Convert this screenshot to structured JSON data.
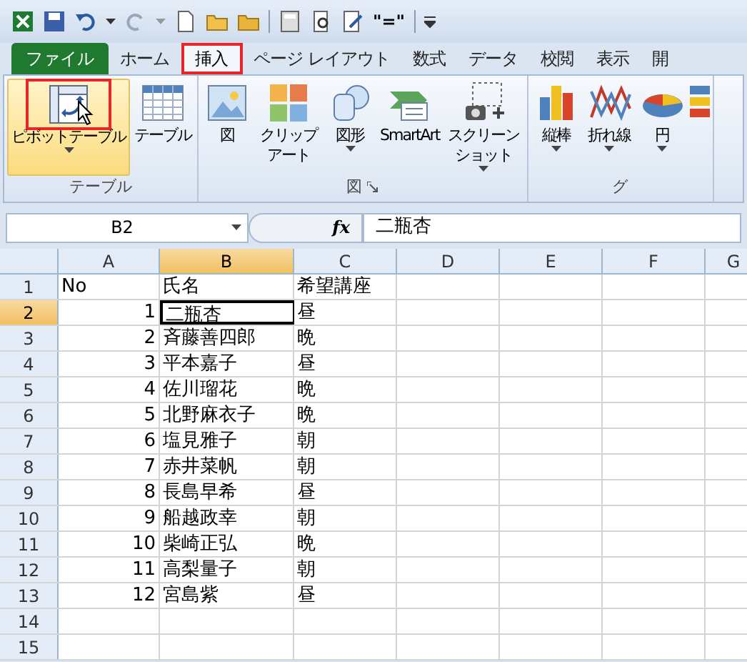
{
  "quick_access": {
    "formula_button": "\"=\""
  },
  "tabs": [
    {
      "label": "ファイル",
      "kind": "file",
      "selected": false
    },
    {
      "label": "ホーム",
      "kind": "tab",
      "selected": false
    },
    {
      "label": "挿入",
      "kind": "tab",
      "selected": true
    },
    {
      "label": "ページ レイアウト",
      "kind": "tab",
      "selected": false
    },
    {
      "label": "数式",
      "kind": "tab",
      "selected": false
    },
    {
      "label": "データ",
      "kind": "tab",
      "selected": false
    },
    {
      "label": "校閲",
      "kind": "tab",
      "selected": false
    },
    {
      "label": "表示",
      "kind": "tab",
      "selected": false
    },
    {
      "label": "開",
      "kind": "tab",
      "selected": false
    }
  ],
  "ribbon": {
    "groups": [
      {
        "label": "テーブル",
        "launcher": false,
        "buttons": [
          {
            "label": "ピボットテーブル",
            "dropdown": true,
            "highlighted": true
          },
          {
            "label": "テーブル",
            "dropdown": false,
            "highlighted": false
          }
        ]
      },
      {
        "label": "図",
        "launcher": true,
        "buttons": [
          {
            "label": "図",
            "dropdown": false,
            "highlighted": false
          },
          {
            "label": "クリップアート",
            "dropdown": false,
            "highlighted": false
          },
          {
            "label": "図形",
            "dropdown": true,
            "highlighted": false
          },
          {
            "label": "SmartArt",
            "dropdown": false,
            "highlighted": false
          },
          {
            "label": "スクリーンショット",
            "dropdown": true,
            "highlighted": false
          }
        ]
      },
      {
        "label": "グ",
        "launcher": false,
        "buttons": [
          {
            "label": "縦棒",
            "dropdown": true,
            "highlighted": false
          },
          {
            "label": "折れ線",
            "dropdown": true,
            "highlighted": false
          },
          {
            "label": "円",
            "dropdown": true,
            "highlighted": false
          }
        ]
      }
    ]
  },
  "formula_bar": {
    "name_box": "B2",
    "function_label": "fx",
    "formula": "二瓶杏"
  },
  "sheet": {
    "columns": [
      {
        "label": "A",
        "selected": false
      },
      {
        "label": "B",
        "selected": true
      },
      {
        "label": "C",
        "selected": false
      },
      {
        "label": "D",
        "selected": false
      },
      {
        "label": "E",
        "selected": false
      },
      {
        "label": "F",
        "selected": false
      },
      {
        "label": "G",
        "selected": false
      }
    ],
    "rows": [
      {
        "number": "1",
        "selected": false,
        "cells": [
          "No",
          "氏名",
          "希望講座"
        ]
      },
      {
        "number": "2",
        "selected": true,
        "cells": [
          "1",
          "二瓶杏",
          "昼"
        ]
      },
      {
        "number": "3",
        "selected": false,
        "cells": [
          "2",
          "斉藤善四郎",
          "晩"
        ]
      },
      {
        "number": "4",
        "selected": false,
        "cells": [
          "3",
          "平本嘉子",
          "昼"
        ]
      },
      {
        "number": "5",
        "selected": false,
        "cells": [
          "4",
          "佐川瑠花",
          "晩"
        ]
      },
      {
        "number": "6",
        "selected": false,
        "cells": [
          "5",
          "北野麻衣子",
          "晩"
        ]
      },
      {
        "number": "7",
        "selected": false,
        "cells": [
          "6",
          "塩見雅子",
          "朝"
        ]
      },
      {
        "number": "8",
        "selected": false,
        "cells": [
          "7",
          "赤井菜帆",
          "朝"
        ]
      },
      {
        "number": "9",
        "selected": false,
        "cells": [
          "8",
          "長島早希",
          "昼"
        ]
      },
      {
        "number": "10",
        "selected": false,
        "cells": [
          "9",
          "船越政幸",
          "朝"
        ]
      },
      {
        "number": "11",
        "selected": false,
        "cells": [
          "10",
          "柴崎正弘",
          "晩"
        ]
      },
      {
        "number": "12",
        "selected": false,
        "cells": [
          "11",
          "高梨量子",
          "朝"
        ]
      },
      {
        "number": "13",
        "selected": false,
        "cells": [
          "12",
          "宮島紫",
          "昼"
        ]
      },
      {
        "number": "14",
        "selected": false
      },
      {
        "number": "15",
        "selected": false
      }
    ]
  }
}
